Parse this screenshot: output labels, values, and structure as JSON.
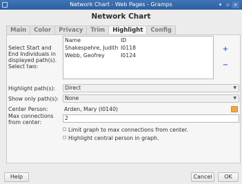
{
  "window": {
    "title": "Network Chart - Web Pages - Gramps",
    "controls": [
      "▾",
      "▫",
      "×"
    ]
  },
  "dialog": {
    "title": "Network Chart"
  },
  "tabs": [
    {
      "label": "Main"
    },
    {
      "label": "Color"
    },
    {
      "label": "Privacy"
    },
    {
      "label": "Trim"
    },
    {
      "label": "Highlight"
    },
    {
      "label": "Config"
    }
  ],
  "highlight": {
    "select_label": "Select Start and End Individuals in displayed path(s). Select two:",
    "columns": [
      "Name",
      "ID"
    ],
    "people": [
      {
        "name": "Shakespehre, Judith",
        "id": "I0118"
      },
      {
        "name": "Webb, Geofrey",
        "id": "I0124"
      }
    ],
    "add_symbol": "+",
    "remove_symbol": "−",
    "highlight_paths_label": "Highlight path(s):",
    "highlight_paths_value": "Direct",
    "show_only_label": "Show only path(s):",
    "show_only_value": "None",
    "center_label": "Center Person:",
    "center_value": "Arden, Mary (I0140)",
    "max_conn_label": "Max connections from center:",
    "max_conn_value": "2",
    "limit_label": "Limit graph to max connections from center.",
    "highlight_center_label": "Highlight central person in graph."
  },
  "footer": {
    "help": "Help",
    "cancel": "Cancel",
    "ok": "OK"
  }
}
